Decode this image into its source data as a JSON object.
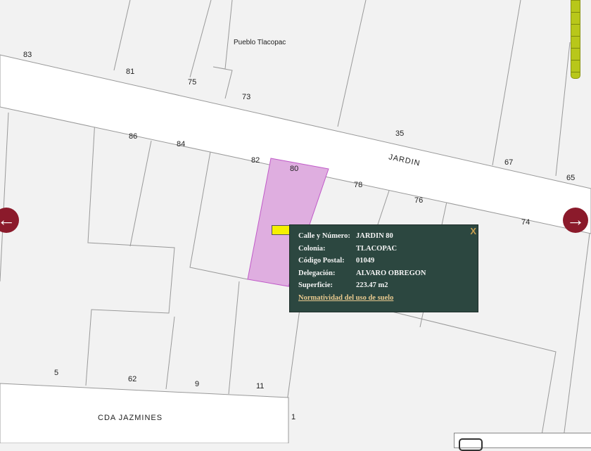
{
  "map": {
    "place_label": "Pueblo Tlacopac",
    "streets": [
      "JARDIN",
      "CDA JAZMINES"
    ],
    "lot_numbers": [
      "83",
      "81",
      "75",
      "73",
      "35",
      "67",
      "65",
      "86",
      "84",
      "82",
      "80",
      "78",
      "76",
      "74",
      "5",
      "62",
      "9",
      "11",
      "1"
    ]
  },
  "popup": {
    "fields": [
      {
        "label": "Calle y Número:",
        "value": "JARDIN 80"
      },
      {
        "label": "Colonia:",
        "value": "TLACOPAC"
      },
      {
        "label": "Código Postal:",
        "value": "01049"
      },
      {
        "label": "Delegación:",
        "value": "ALVARO OBREGON"
      },
      {
        "label": "Superficie:",
        "value": "223.47 m2"
      }
    ],
    "link": "Normatividad del uso de suelo",
    "close": "X"
  },
  "nav": {
    "prev": "←",
    "next": "→"
  },
  "colors": {
    "selected_parcel": "#dfaee0",
    "popup_bg": "#2c4740",
    "nav": "#8b1a2b"
  }
}
